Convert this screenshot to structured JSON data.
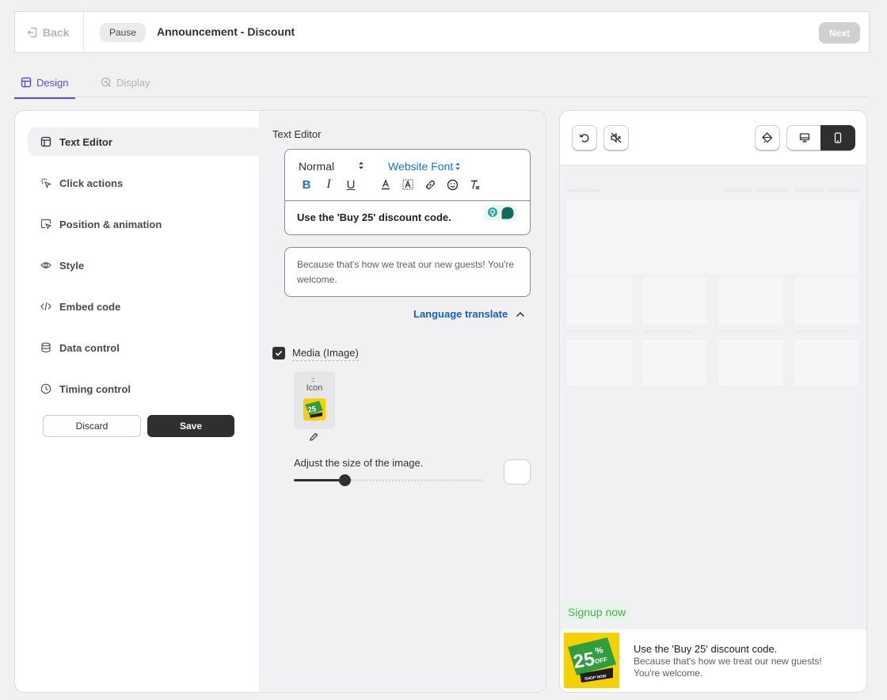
{
  "header": {
    "back_label": "Back",
    "pause_label": "Pause",
    "title": "Announcement - Discount",
    "next_label": "Next"
  },
  "tabs": [
    {
      "label": "Design",
      "active": true
    },
    {
      "label": "Display",
      "active": false
    }
  ],
  "sidebar": {
    "items": [
      {
        "label": "Text Editor",
        "icon": "layout-icon",
        "active": true
      },
      {
        "label": "Click actions",
        "icon": "click-icon"
      },
      {
        "label": "Position & animation",
        "icon": "cursor-window-icon"
      },
      {
        "label": "Style",
        "icon": "eye-icon"
      },
      {
        "label": "Embed code",
        "icon": "code-icon"
      },
      {
        "label": "Data control",
        "icon": "database-icon"
      },
      {
        "label": "Timing control",
        "icon": "clock-icon"
      }
    ],
    "discard_label": "Discard",
    "save_label": "Save"
  },
  "editor": {
    "section_label": "Text Editor",
    "block_format": "Normal",
    "font": "Website Font",
    "format_buttons": {
      "bold": "B",
      "italic": "I",
      "underline": "U"
    },
    "headline": "Use the 'Buy 25' discount code.",
    "description": "Because that's how we treat our new guests! You're welcome.",
    "language_translate_label": "Language translate",
    "media_label": "Media (Image)",
    "media_checked": true,
    "icon_tile_label": "Icon",
    "icon_tile_handle": ":::",
    "adjust_label": "Adjust the size of the image.",
    "image_size_percent": 27
  },
  "badge_image": {
    "number": "25",
    "percent": "%",
    "off": "OFF",
    "shop": "SHOP NOW"
  },
  "preview": {
    "signup_label": "Signup now",
    "bar_title": "Use the 'Buy 25' discount code.",
    "bar_desc_line1": "Because that's how we treat our new guests!",
    "bar_desc_line2": "You're welcome.",
    "mode": "mobile"
  },
  "colors": {
    "accent": "#5a4fcf",
    "link": "#1a5fb4",
    "dark": "#2f2f2f",
    "badge_yellow": "#f5d100",
    "badge_green": "#2e9e3f",
    "signup_green": "#4caf50"
  }
}
